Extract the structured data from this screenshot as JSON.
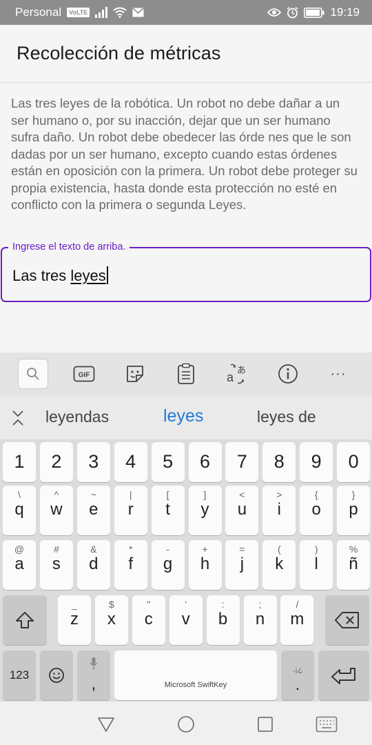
{
  "status": {
    "carrier": "Personal",
    "network_badge": "VoLTE",
    "time": "19:19",
    "icons": [
      "signal-icon",
      "wifi-icon",
      "mail-icon",
      "eye-icon",
      "alarm-icon",
      "battery-icon"
    ]
  },
  "appbar": {
    "title": "Recolección de métricas"
  },
  "content": {
    "paragraph": "Las tres leyes de la robótica. Un robot no debe dañar a un ser humano o, por su inacción, dejar que un ser humano sufra daño. Un robot debe obedecer las órde nes que le son dadas por un ser humano, excepto cuando estas órdenes están en oposición con la primera. Un robot debe proteger su propia existencia, hasta donde esta protección no esté en conflicto con la primera o segunda Leyes."
  },
  "field": {
    "label": "Ingrese el texto de arriba.",
    "value_prefix": "Las tres ",
    "value_composing": "leyes"
  },
  "keyboard": {
    "toolbar": [
      "search-icon",
      "gif-icon",
      "sticker-icon",
      "clipboard-icon",
      "translate-icon",
      "info-icon",
      "more-icon"
    ],
    "gif_label": "GIF",
    "more_label": "···",
    "suggestions": [
      "leyendas",
      "leyes",
      "leyes de"
    ],
    "row_numbers": [
      "1",
      "2",
      "3",
      "4",
      "5",
      "6",
      "7",
      "8",
      "9",
      "0"
    ],
    "row1": [
      {
        "sub": "\\",
        "main": "q"
      },
      {
        "sub": "^",
        "main": "w"
      },
      {
        "sub": "~",
        "main": "e"
      },
      {
        "sub": "|",
        "main": "r"
      },
      {
        "sub": "[",
        "main": "t"
      },
      {
        "sub": "]",
        "main": "y"
      },
      {
        "sub": "<",
        "main": "u"
      },
      {
        "sub": ">",
        "main": "i"
      },
      {
        "sub": "{",
        "main": "o"
      },
      {
        "sub": "}",
        "main": "p"
      }
    ],
    "row2": [
      {
        "sub": "@",
        "main": "a"
      },
      {
        "sub": "#",
        "main": "s"
      },
      {
        "sub": "&",
        "main": "d"
      },
      {
        "sub": "*",
        "main": "f"
      },
      {
        "sub": "-",
        "main": "g"
      },
      {
        "sub": "+",
        "main": "h"
      },
      {
        "sub": "=",
        "main": "j"
      },
      {
        "sub": "(",
        "main": "k"
      },
      {
        "sub": ")",
        "main": "l"
      },
      {
        "sub": "%",
        "main": "ñ"
      }
    ],
    "row3": [
      {
        "sub": "_",
        "main": "z"
      },
      {
        "sub": "$",
        "main": "x"
      },
      {
        "sub": "\"",
        "main": "c"
      },
      {
        "sub": "'",
        "main": "v"
      },
      {
        "sub": ":",
        "main": "b"
      },
      {
        "sub": ";",
        "main": "n"
      },
      {
        "sub": "/",
        "main": "m"
      }
    ],
    "symbols_key": "123",
    "comma_key": ",",
    "period_key": ".",
    "period_sub": ".¡¿",
    "space_label": "Microsoft SwiftKey"
  },
  "colors": {
    "accent": "#6a1ec4",
    "suggestion": "#1f7ad6"
  }
}
